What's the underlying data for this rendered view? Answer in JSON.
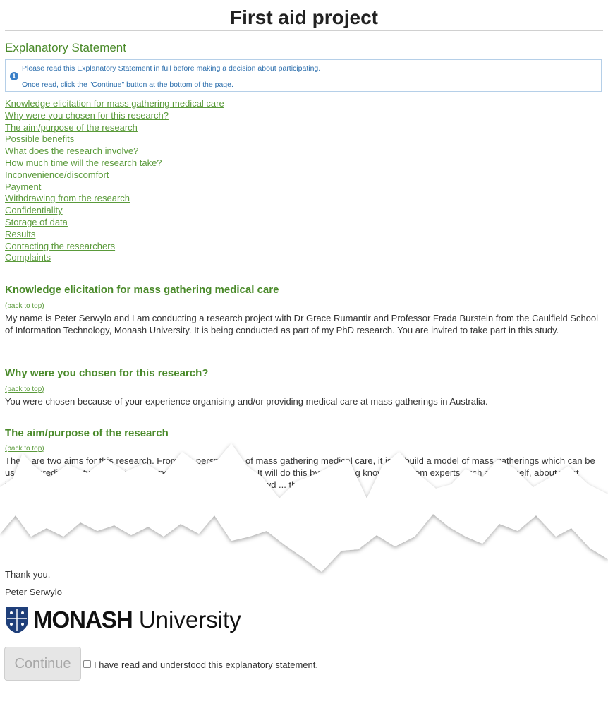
{
  "page": {
    "title": "First aid project"
  },
  "statement": {
    "heading": "Explanatory Statement",
    "info_lines": [
      "Please read this Explanatory Statement in full before making a decision about participating.",
      "Once read, click the \"Continue\" button at the bottom of the page."
    ]
  },
  "toc": [
    "Knowledge elicitation for mass gathering medical care",
    "Why were you chosen for this research?",
    "The aim/purpose of the research",
    "Possible benefits",
    "What does the research involve?",
    "How much time will the research take?",
    "Inconvenience/discomfort",
    "Payment",
    "Withdrawing from the research",
    "Confidentiality",
    "Storage of data",
    "Results",
    "Contacting the researchers",
    "Complaints"
  ],
  "back_to_top": "(back to top)",
  "sections": [
    {
      "heading": "Knowledge elicitation for mass gathering medical care",
      "body": "My name is Peter Serwylo and I am conducting a research project with Dr Grace Rumantir and Professor Frada Burstein from the Caulfield School of Information Technology, Monash University. It is being conducted as part of my PhD research. You are invited to take part in this study."
    },
    {
      "heading": "Why were you chosen for this research?",
      "body": "You were chosen because of your experience organising and/or providing medical care at mass gatherings in Australia."
    },
    {
      "heading": "The aim/purpose of the research",
      "body": "There are two aims for this research. From the perspective of mass gathering medical care, it is to build a model of mass gatherings which can be used to predict the types of injuries expected at future events. It will do this by gathering knowledge from experts such as yourself, about what influences injuries and illnesses such as weather conditions, crowd ... the type of event."
    }
  ],
  "closing": {
    "thanks": "Thank you,",
    "signoff": "Peter Serwylo"
  },
  "logo": {
    "bold": "MONASH",
    "light": " University"
  },
  "footer": {
    "continue_label": "Continue",
    "agree_label": "I have read and understood this explanatory statement."
  }
}
